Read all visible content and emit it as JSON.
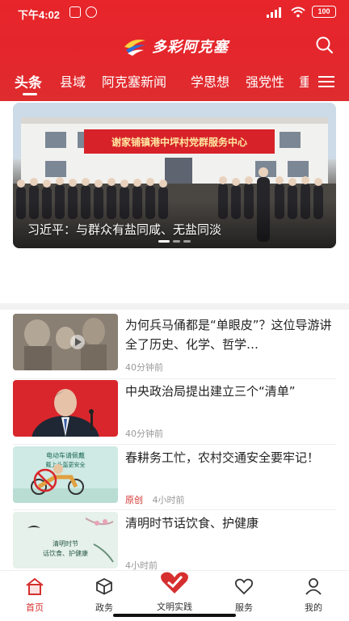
{
  "status_bar": {
    "time": "下午4:02",
    "battery": "100"
  },
  "header": {
    "app_name": "多彩阿克塞"
  },
  "tabs": [
    {
      "label": "头条"
    },
    {
      "label": "县域"
    },
    {
      "label": "阿克塞新闻"
    },
    {
      "label": "学思想"
    },
    {
      "label": "强党性"
    },
    {
      "label": "重"
    }
  ],
  "banner": {
    "caption": "习近平：与群众有盐同咸、无盐同淡",
    "sign_text": "谢家铺镇港中坪村党群服务中心",
    "page_count": 3,
    "active_page": 1
  },
  "news": [
    {
      "title": "为何兵马俑都是“单眼皮”？这位导游讲全了历史、化学、哲学…",
      "time": "40分钟前",
      "tag": ""
    },
    {
      "title": "中央政治局提出建立三个“清单”",
      "time": "40分钟前",
      "tag": ""
    },
    {
      "title": "春耕务工忙，农村交通安全要牢记！",
      "time": "4小时前",
      "tag": "原创"
    },
    {
      "title": "清明时节话饮食、护健康",
      "time": "4小时前",
      "tag": ""
    }
  ],
  "thumb_text": {
    "spring_title": "电动车请佩戴",
    "spring_sub": "戴上头盔更安全",
    "qingming_line1": "清明时节",
    "qingming_line2": "话饮食、护健康"
  },
  "tabbar": [
    {
      "label": "首页"
    },
    {
      "label": "政务"
    },
    {
      "label": "文明实践"
    },
    {
      "label": "服务"
    },
    {
      "label": "我的"
    }
  ],
  "colors": {
    "accent": "#e3272c",
    "tag": "#d4332e"
  }
}
